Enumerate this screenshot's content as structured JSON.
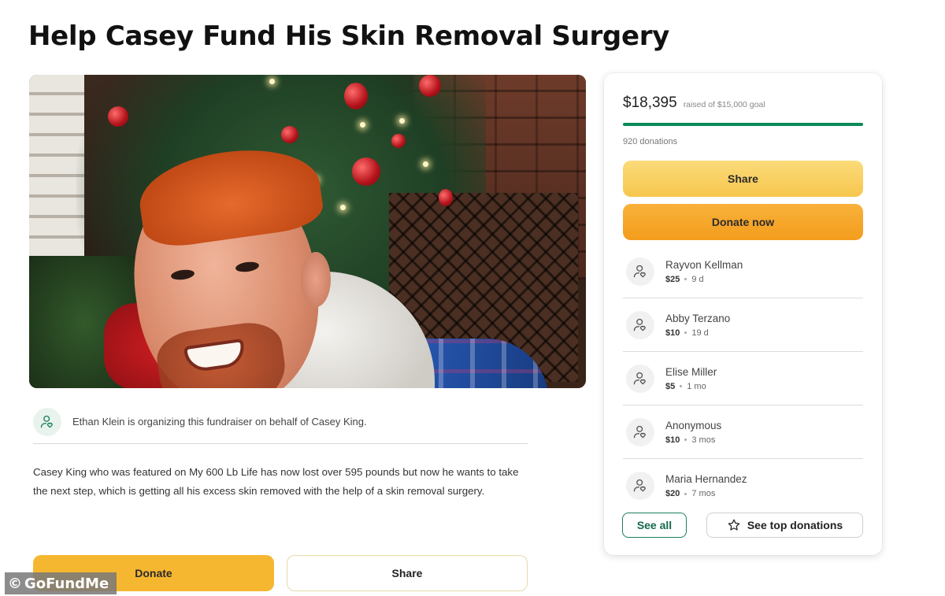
{
  "page": {
    "title": "Help Casey Fund His Skin Removal Surgery"
  },
  "organizer": {
    "icon": "user-heart-icon",
    "text": "Ethan Klein is organizing this fundraiser on behalf of Casey King."
  },
  "story": {
    "text": "Casey King who was featured on My 600 Lb Life has now lost over 595 pounds but now he wants to take the next step, which is getting all his excess skin removed with the help of a skin removal surgery."
  },
  "main_actions": {
    "donate_label": "Donate",
    "share_label": "Share"
  },
  "sidebar": {
    "raised": "$18,395",
    "goal_text": "raised of $15,000 goal",
    "progress_fraction": 1.0,
    "donations_count": "920 donations",
    "share_label": "Share",
    "donate_label": "Donate now",
    "donors": [
      {
        "name": "Rayvon Kellman",
        "amount": "$25",
        "time": "9 d"
      },
      {
        "name": "Abby Terzano",
        "amount": "$10",
        "time": "19 d"
      },
      {
        "name": "Elise Miller",
        "amount": "$5",
        "time": "1 mo"
      },
      {
        "name": "Anonymous",
        "amount": "$10",
        "time": "3 mos"
      },
      {
        "name": "Maria Hernandez",
        "amount": "$20",
        "time": "7 mos"
      }
    ],
    "see_all_label": "See all",
    "top_donations_label": "See top donations",
    "top_donations_icon": "star-icon"
  },
  "watermark": {
    "symbol": "©",
    "text": "GoFundMe"
  },
  "colors": {
    "brand_green": "#0b8a5a",
    "donate_orange": "#f39d1c",
    "share_yellow": "#f6c64d"
  }
}
